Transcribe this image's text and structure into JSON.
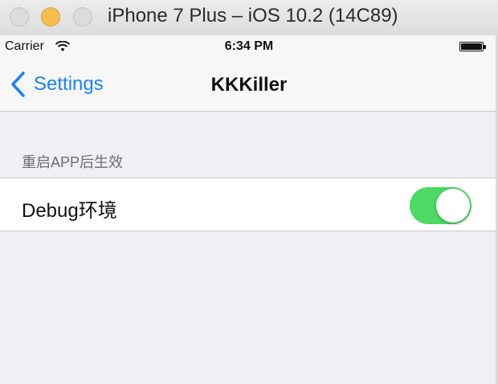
{
  "window": {
    "title": "iPhone 7 Plus – iOS 10.2 (14C89)"
  },
  "status_bar": {
    "carrier": "Carrier",
    "time": "6:34 PM",
    "wifi_icon": "wifi-icon",
    "battery_icon": "battery-icon"
  },
  "nav_bar": {
    "back_label": "Settings",
    "title": "KKKiller"
  },
  "section": {
    "header": "重启APP后生效",
    "cells": [
      {
        "label": "Debug环境",
        "toggle_on": true
      }
    ]
  },
  "colors": {
    "tint": "#1a82fb",
    "switch_on": "#4cd964",
    "background": "#efeff4"
  }
}
